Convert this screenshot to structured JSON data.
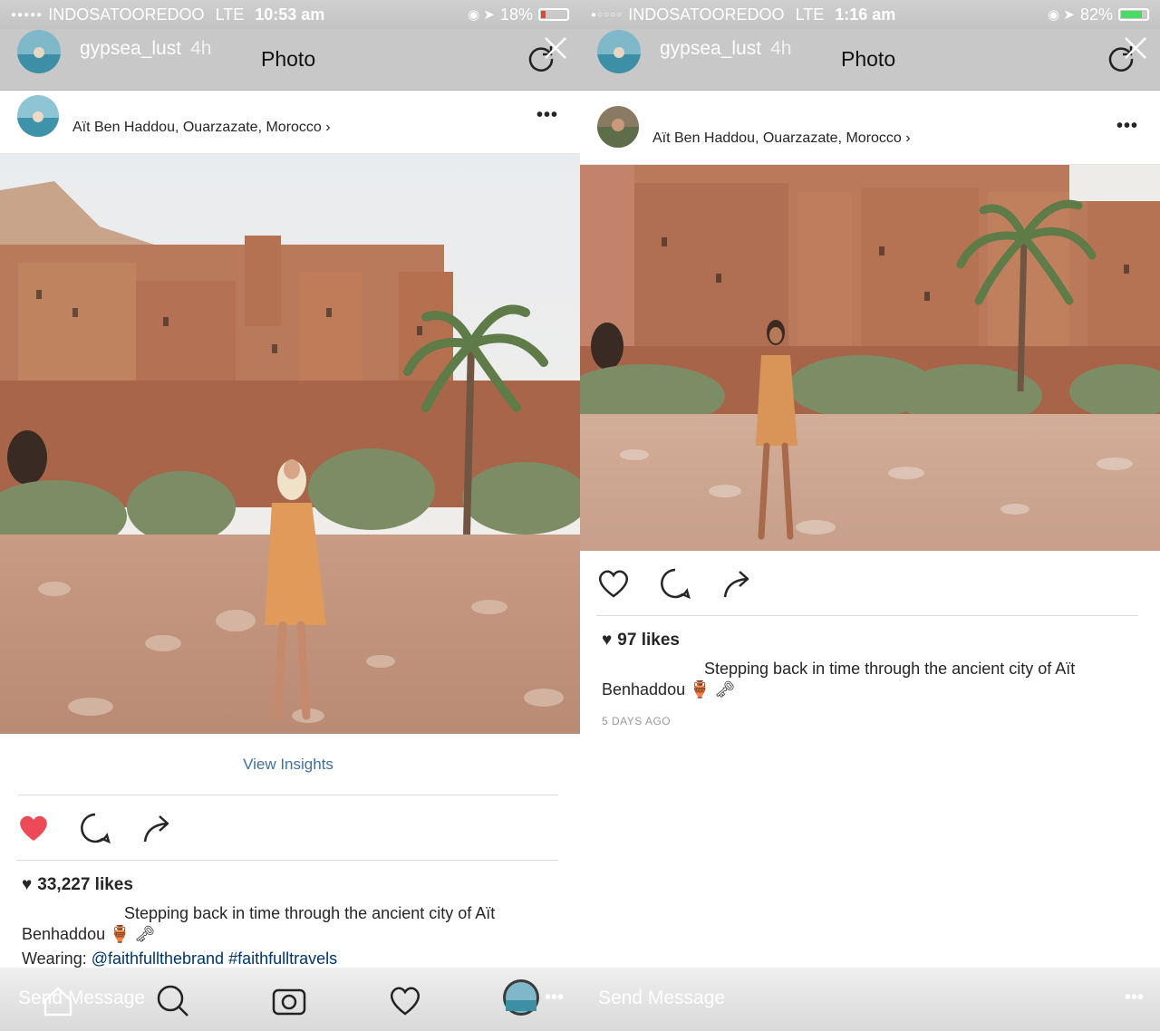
{
  "left": {
    "status": {
      "carrier": "INDOSATOOREDOO",
      "network": "LTE",
      "time": "10:53 am",
      "battery": "18%",
      "battery_level": 0.18,
      "battery_color": "#e0443d"
    },
    "story": {
      "username": "gypsea_lust",
      "age": "4h",
      "title": "Photo"
    },
    "post": {
      "location": "Aït Ben Haddou, Ouarzazate, Morocco",
      "insights": "View Insights",
      "likes": "33,227 likes",
      "caption_line1": "Stepping back in time through the ancient city of Aït",
      "caption_line2": "Benhaddou 🏺 🗝",
      "wearing_label": "Wearing: ",
      "wearing_tags": "@faithfullthebrand #faithfulltravels"
    },
    "bottom": {
      "send": "Send Message",
      "dots": "•••"
    },
    "tabs": [
      "home-icon",
      "search-icon",
      "camera-icon",
      "heart-icon",
      "profile-icon"
    ]
  },
  "right": {
    "status": {
      "carrier": "INDOSATOOREDOO",
      "network": "LTE",
      "time": "1:16 am",
      "battery": "82%",
      "battery_level": 0.82,
      "battery_color": "#4cd964"
    },
    "story": {
      "username": "gypsea_lust",
      "age": "4h",
      "title": "Photo"
    },
    "post": {
      "location": "Aït Ben Haddou, Ouarzazate, Morocco",
      "likes": "97 likes",
      "caption_line1": "Stepping back in time through the ancient city of Aït",
      "caption_line2": "Benhaddou 🏺 🗝",
      "ago": "5 DAYS AGO"
    },
    "bottom": {
      "send": "Send Message",
      "dots": "•••"
    }
  },
  "colors": {
    "like_red": "#ed4956",
    "link_blue": "#3f729b",
    "tag_blue": "#003569"
  }
}
